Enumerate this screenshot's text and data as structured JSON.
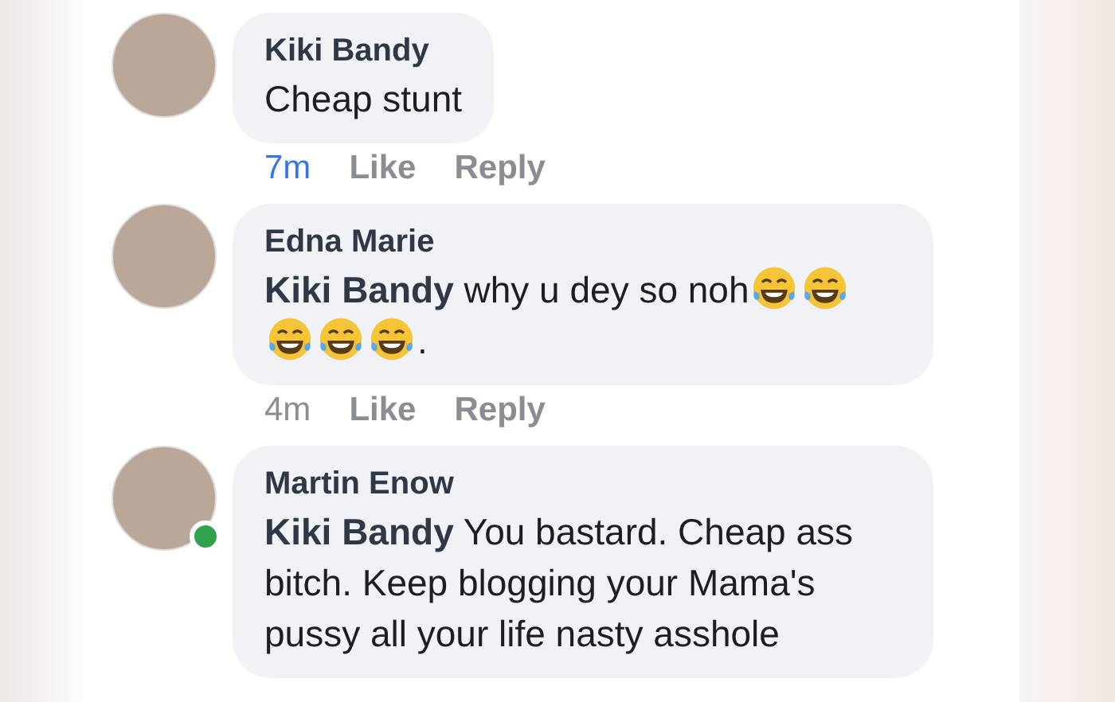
{
  "comments": [
    {
      "author": "Kiki Bandy",
      "online": false,
      "body": [
        {
          "kind": "text",
          "text": "Cheap stunt"
        }
      ],
      "time": "7m",
      "time_new": true,
      "actions": [
        "Like",
        "Reply"
      ]
    },
    {
      "author": "Edna Marie",
      "online": false,
      "mention": "Kiki Bandy",
      "body": [
        {
          "kind": "text",
          "text": "why u dey so noh"
        },
        {
          "kind": "emoji"
        },
        {
          "kind": "emoji"
        },
        {
          "kind": "emoji"
        },
        {
          "kind": "emoji"
        },
        {
          "kind": "emoji"
        },
        {
          "kind": "text",
          "text": "."
        }
      ],
      "time": "4m",
      "time_new": false,
      "actions": [
        "Like",
        "Reply"
      ]
    },
    {
      "author": "Martin Enow",
      "online": true,
      "mention": "Kiki Bandy",
      "body": [
        {
          "kind": "text",
          "text": "You bastard. Cheap ass bitch. Keep blogging your Mama's pussy all your life nasty asshole"
        }
      ]
    }
  ]
}
